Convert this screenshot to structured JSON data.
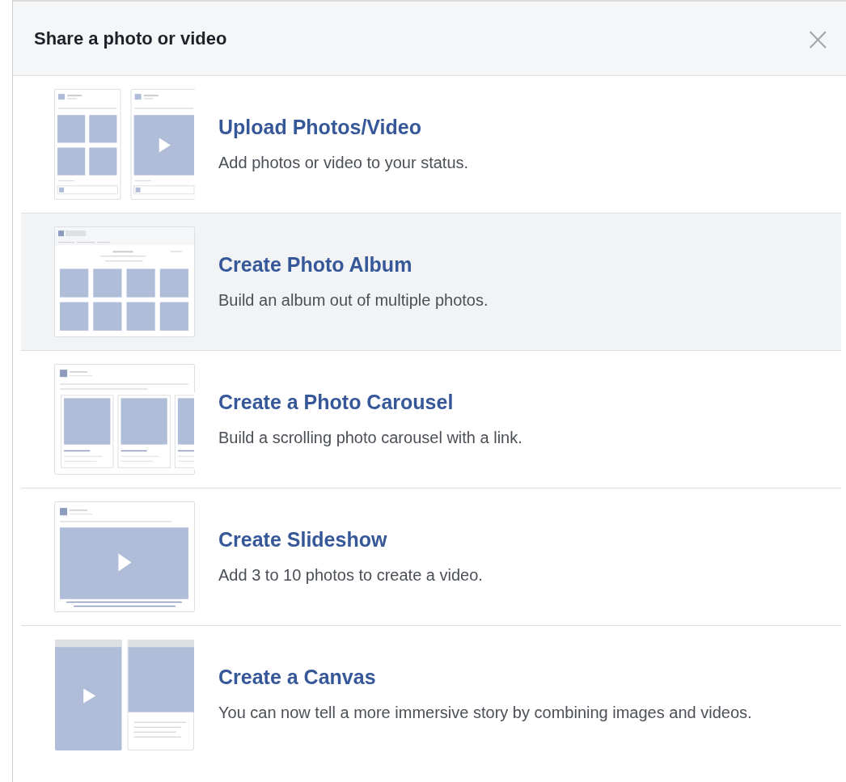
{
  "dialog": {
    "title": "Share a photo or video",
    "close": "×"
  },
  "options": [
    {
      "kind": "upload",
      "title": "Upload Photos/Video",
      "description": "Add photos or video to your status.",
      "selected": false
    },
    {
      "kind": "album",
      "title": "Create Photo Album",
      "description": "Build an album out of multiple photos.",
      "selected": true
    },
    {
      "kind": "carousel",
      "title": "Create a Photo Carousel",
      "description": "Build a scrolling photo carousel with a link.",
      "selected": false
    },
    {
      "kind": "slideshow",
      "title": "Create Slideshow",
      "description": "Add 3 to 10 photos to create a video.",
      "selected": false
    },
    {
      "kind": "canvas",
      "title": "Create a Canvas",
      "description": "You can now tell a more immersive story by combining images and videos.",
      "selected": false
    }
  ]
}
